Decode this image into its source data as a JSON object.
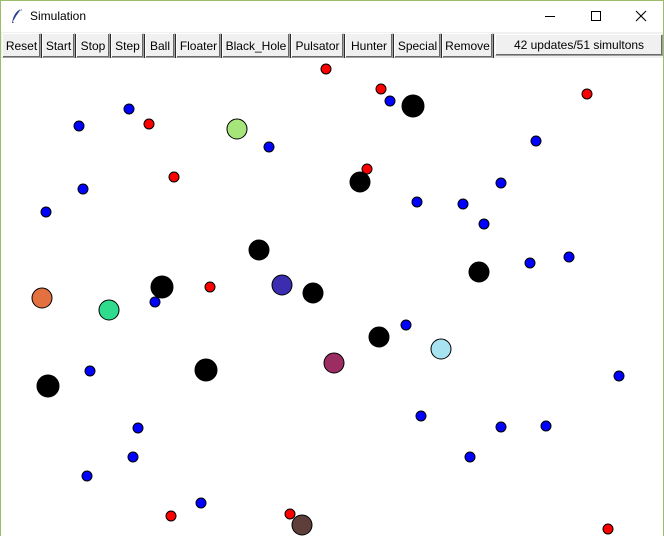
{
  "window": {
    "title": "Simulation"
  },
  "toolbar": {
    "buttons": [
      "Reset",
      "Start",
      "Stop",
      "Step",
      "Ball",
      "Floater",
      "Black_Hole",
      "Pulsator",
      "Hunter",
      "Special",
      "Remove"
    ],
    "status": "42 updates/51 simultons"
  },
  "colors": {
    "ball": "#0000ff",
    "floater": "#ff0000",
    "black_hole": "#000000"
  },
  "simultons": [
    {
      "kind": "floater",
      "r": 5
    },
    {
      "kind": "floater",
      "r": 5
    },
    {
      "kind": "ball",
      "r": 5
    },
    {
      "kind": "black_hole",
      "r": 11
    },
    {
      "kind": "floater",
      "r": 5
    },
    {
      "kind": "ball",
      "r": 5
    },
    {
      "kind": "ball",
      "r": 5
    },
    {
      "kind": "floater",
      "r": 5
    },
    {
      "kind": "pulsator",
      "r": 10,
      "fill": "#a6e57a"
    },
    {
      "kind": "ball",
      "r": 5
    },
    {
      "kind": "ball",
      "r": 5
    },
    {
      "kind": "floater",
      "r": 5
    },
    {
      "kind": "floater",
      "r": 5
    },
    {
      "kind": "black_hole",
      "r": 10
    },
    {
      "kind": "ball",
      "r": 5
    },
    {
      "kind": "ball",
      "r": 5
    },
    {
      "kind": "ball",
      "r": 5
    },
    {
      "kind": "ball",
      "r": 5
    },
    {
      "kind": "ball",
      "r": 5
    },
    {
      "kind": "ball",
      "r": 5
    },
    {
      "kind": "black_hole",
      "r": 10
    },
    {
      "kind": "ball",
      "r": 5
    },
    {
      "kind": "ball",
      "r": 5
    },
    {
      "kind": "black_hole",
      "r": 10
    },
    {
      "kind": "pulsator",
      "r": 10,
      "fill": "#e3703f"
    },
    {
      "kind": "black_hole",
      "r": 11
    },
    {
      "kind": "floater",
      "r": 5
    },
    {
      "kind": "hunter",
      "r": 10,
      "fill": "#3b2db0"
    },
    {
      "kind": "black_hole",
      "r": 10
    },
    {
      "kind": "ball",
      "r": 5
    },
    {
      "kind": "pulsator",
      "r": 10,
      "fill": "#2fdc8d"
    },
    {
      "kind": "ball",
      "r": 5
    },
    {
      "kind": "black_hole",
      "r": 10
    },
    {
      "kind": "pulsator",
      "r": 10,
      "fill": "#9c2d63"
    },
    {
      "kind": "pulsator",
      "r": 10,
      "fill": "#a7e3f0"
    },
    {
      "kind": "black_hole",
      "r": 11
    },
    {
      "kind": "ball",
      "r": 5
    },
    {
      "kind": "black_hole",
      "r": 11
    },
    {
      "kind": "ball",
      "r": 5
    },
    {
      "kind": "ball",
      "r": 5
    },
    {
      "kind": "ball",
      "r": 5
    },
    {
      "kind": "ball",
      "r": 5
    },
    {
      "kind": "ball",
      "r": 5
    },
    {
      "kind": "ball",
      "r": 5
    },
    {
      "kind": "ball",
      "r": 5
    },
    {
      "kind": "ball",
      "r": 5
    },
    {
      "kind": "floater",
      "r": 5
    },
    {
      "kind": "floater",
      "r": 5
    },
    {
      "kind": "pulsator",
      "r": 10,
      "fill": "#5e3e3a"
    },
    {
      "kind": "floater",
      "r": 5
    },
    {
      "kind": "ball",
      "r": 5
    }
  ]
}
